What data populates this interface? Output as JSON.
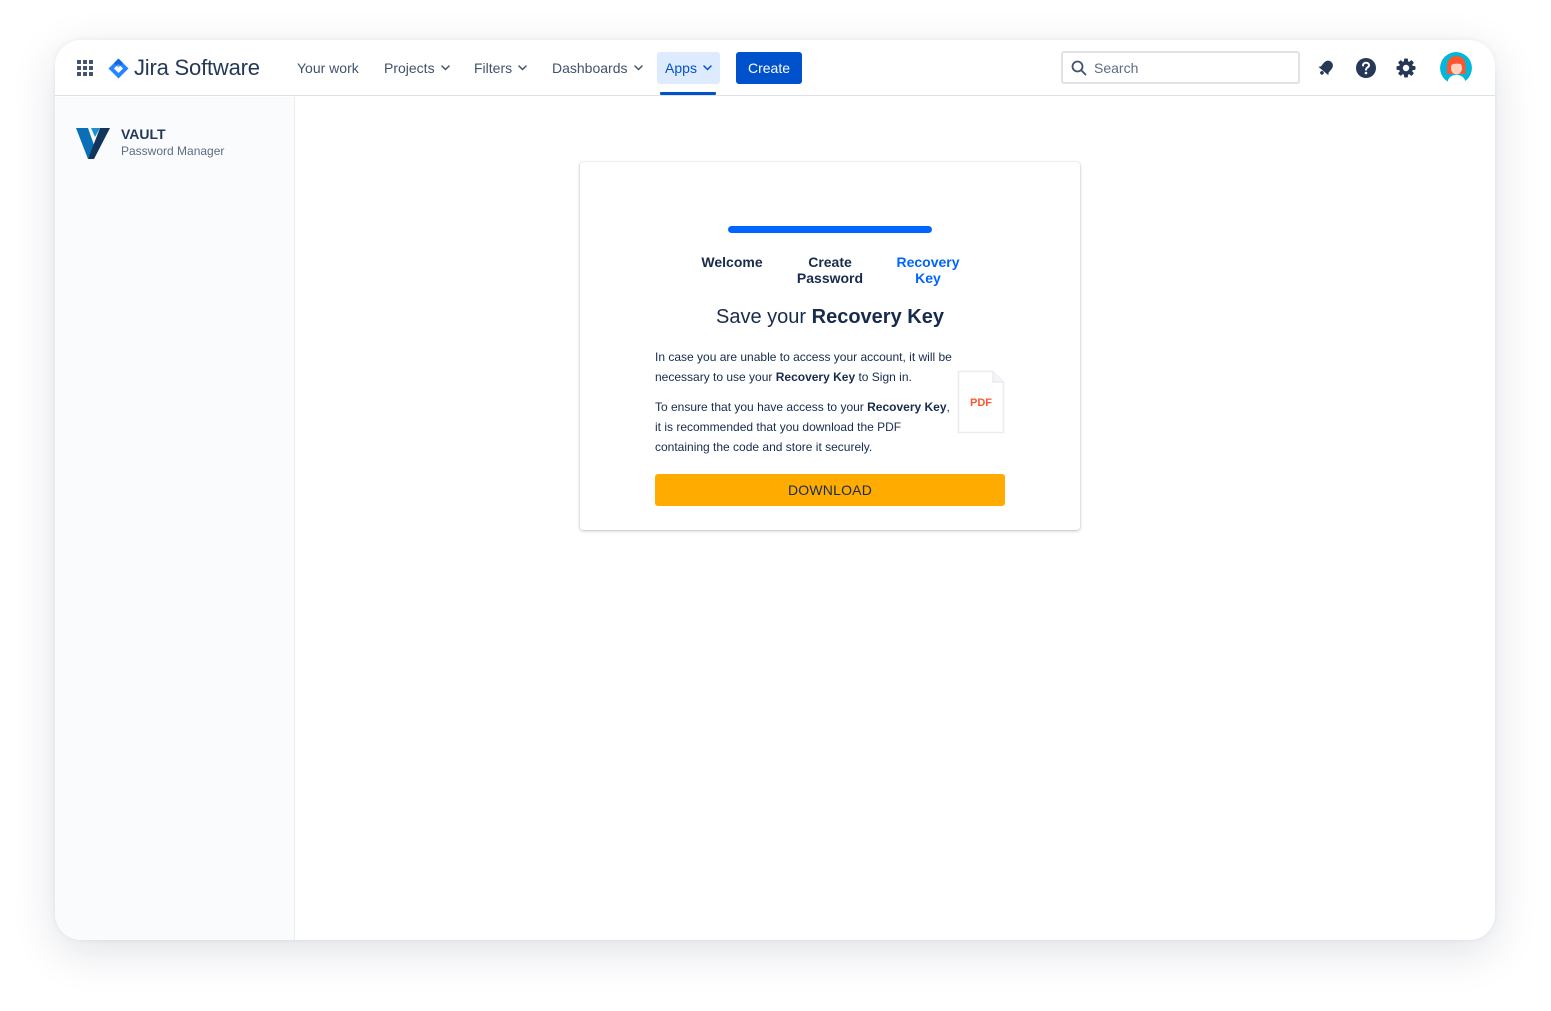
{
  "nav": {
    "app_name": "Jira Software",
    "items": [
      {
        "label": "Your work",
        "has_dropdown": false
      },
      {
        "label": "Projects",
        "has_dropdown": true
      },
      {
        "label": "Filters",
        "has_dropdown": true
      },
      {
        "label": "Dashboards",
        "has_dropdown": true
      }
    ],
    "apps_label": "Apps",
    "create_label": "Create",
    "search_placeholder": "Search",
    "icons": [
      "app-switcher-icon",
      "jira-logo-icon",
      "search-icon",
      "notifications-icon",
      "help-icon",
      "settings-icon",
      "avatar"
    ]
  },
  "sidebar": {
    "app_name": "VAULT",
    "app_subtitle": "Password Manager"
  },
  "wizard": {
    "progress": 1.0,
    "steps": [
      {
        "line1": "Welcome",
        "line2": "",
        "active": false
      },
      {
        "line1": "Create",
        "line2": "Password",
        "active": false
      },
      {
        "line1": "Recovery",
        "line2": "Key",
        "active": true
      }
    ],
    "title_prefix": "Save your ",
    "title_bold": "Recovery Key",
    "p1_pre": "In case you are unable to access your account, it will be necessary to use your ",
    "p1_bold": "Recovery Key",
    "p1_post": " to Sign in.",
    "p2_pre": "To ensure that you have access to your ",
    "p2_bold": "Recovery Key",
    "p2_post": ", it is recommended that you download the PDF containing the code and store it securely.",
    "pdf_label": "PDF",
    "download_label": "DOWNLOAD"
  },
  "colors": {
    "brand_blue": "#0052cc",
    "active_step": "#0065ff",
    "download_button": "#ffab00",
    "pdf_label": "#ff5630"
  }
}
